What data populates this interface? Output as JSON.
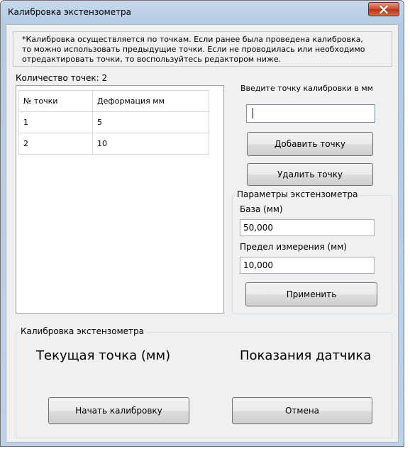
{
  "window": {
    "title": "Калибровка экстензометра",
    "close_icon": "close-icon"
  },
  "info": {
    "text": "*Калибровка осуществляется по точкам. Если ранее была проведена калибровка,\nто можно использовать предыдущие точки. Если не проводилась или необходимо\nотредактировать точки, то воспользуйтесь редактором ниже."
  },
  "points": {
    "count_label": "Количество точек: 2",
    "columns": [
      "№ точки",
      "Деформация мм"
    ],
    "rows": [
      [
        "1",
        "5"
      ],
      [
        "2",
        "10"
      ]
    ]
  },
  "editor": {
    "enter_label": "Введите точку калибровки в мм",
    "input_value": "",
    "add_button": "Добавить точку",
    "delete_button": "Удалить точку"
  },
  "params": {
    "legend": "Параметры экстензометра",
    "base_label": "База (мм)",
    "base_value": "50,000",
    "limit_label": "Предел измерения (мм)",
    "limit_value": "10,000",
    "apply_button": "Применить"
  },
  "calibration": {
    "legend": "Калибровка экстензометра",
    "current_point_label": "Текущая точка (мм)",
    "sensor_label": "Показания датчика",
    "start_button": "Начать калибровку",
    "cancel_button": "Отмена"
  }
}
